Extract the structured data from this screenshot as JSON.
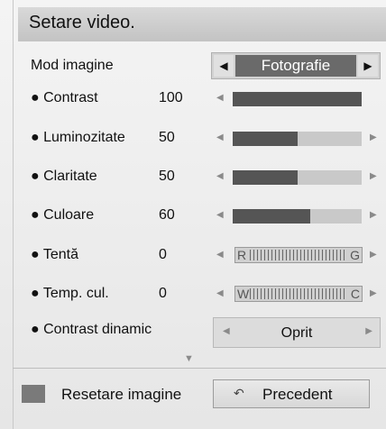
{
  "title": "Setare video.",
  "mode": {
    "label": "Mod imagine",
    "value": "Fotografie"
  },
  "settings": [
    {
      "label": "● Contrast",
      "value": "100",
      "level": 1.0
    },
    {
      "label": "● Luminozitate",
      "value": "50",
      "level": 0.5
    },
    {
      "label": "● Claritate",
      "value": "50",
      "level": 0.5
    },
    {
      "label": "● Culoare",
      "value": "60",
      "level": 0.6
    }
  ],
  "tint": {
    "label": "● Tentă",
    "value": "0",
    "left_letter": "R",
    "right_letter": "G"
  },
  "color_temp": {
    "label": "● Temp. cul.",
    "value": "0",
    "left_letter": "W",
    "right_letter": "C"
  },
  "dynamic_contrast": {
    "label": "● Contrast dinamic",
    "value": "Oprit"
  },
  "footer": {
    "reset_label": "Resetare imagine",
    "previous_label": "Precedent"
  },
  "colors": {
    "bar_fill": "#555555",
    "bar_track": "#c9c9c9",
    "selected": "#6a6a6a"
  }
}
